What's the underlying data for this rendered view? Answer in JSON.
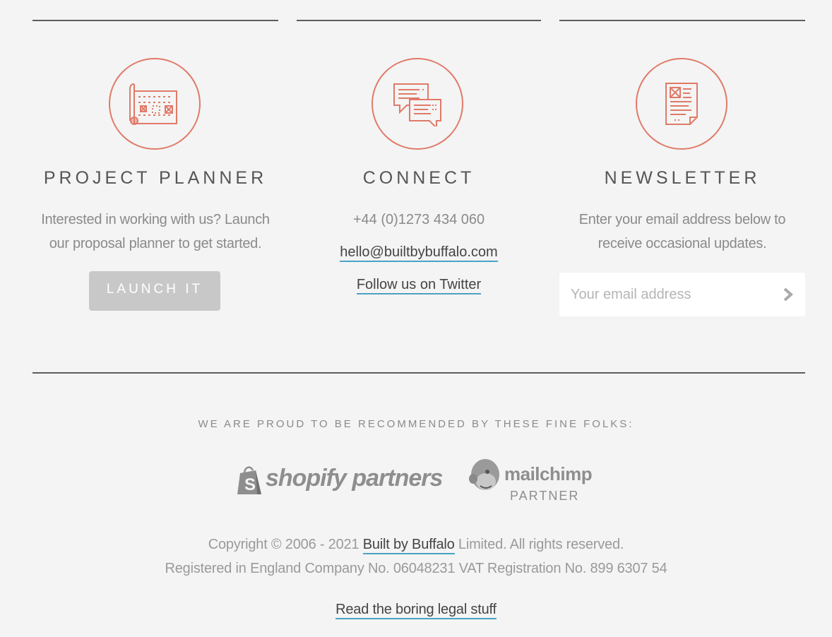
{
  "planner": {
    "heading": "PROJECT PLANNER",
    "description_line1": "Interested in working with us? Launch",
    "description_line2": "our proposal planner to get started.",
    "button_label": "LAUNCH IT",
    "icon": "blueprint-icon"
  },
  "connect": {
    "heading": "CONNECT",
    "phone": "+44 (0)1273 434 060",
    "email": "hello@builtbybuffalo.com",
    "twitter_label": "Follow us on Twitter",
    "icon": "chat-bubbles-icon"
  },
  "newsletter": {
    "heading": "NEWSLETTER",
    "description_line1": "Enter your email address below to",
    "description_line2": "receive occasional updates.",
    "email_placeholder": "Your email address",
    "icon": "document-icon"
  },
  "recommended": {
    "heading": "WE ARE PROUD TO BE RECOMMENDED BY THESE FINE FOLKS:",
    "shopify_logo": "shopify partners",
    "mailchimp_logo_line1": "mailchimp",
    "mailchimp_logo_line2": "PARTNER"
  },
  "footer": {
    "copyright_prefix": "Copyright © 2006 - 2021 ",
    "company_link": "Built by Buffalo",
    "copyright_suffix": " Limited. All rights reserved.",
    "registration": "Registered in England Company No. 06048231 VAT Registration No. 899 6307 54",
    "legal_link": "Read the boring legal stuff"
  },
  "colors": {
    "accent": "#e07a68",
    "link_underline": "#4aa3c4",
    "button_bg": "#c8c8c8",
    "background": "#f4f4f4"
  }
}
